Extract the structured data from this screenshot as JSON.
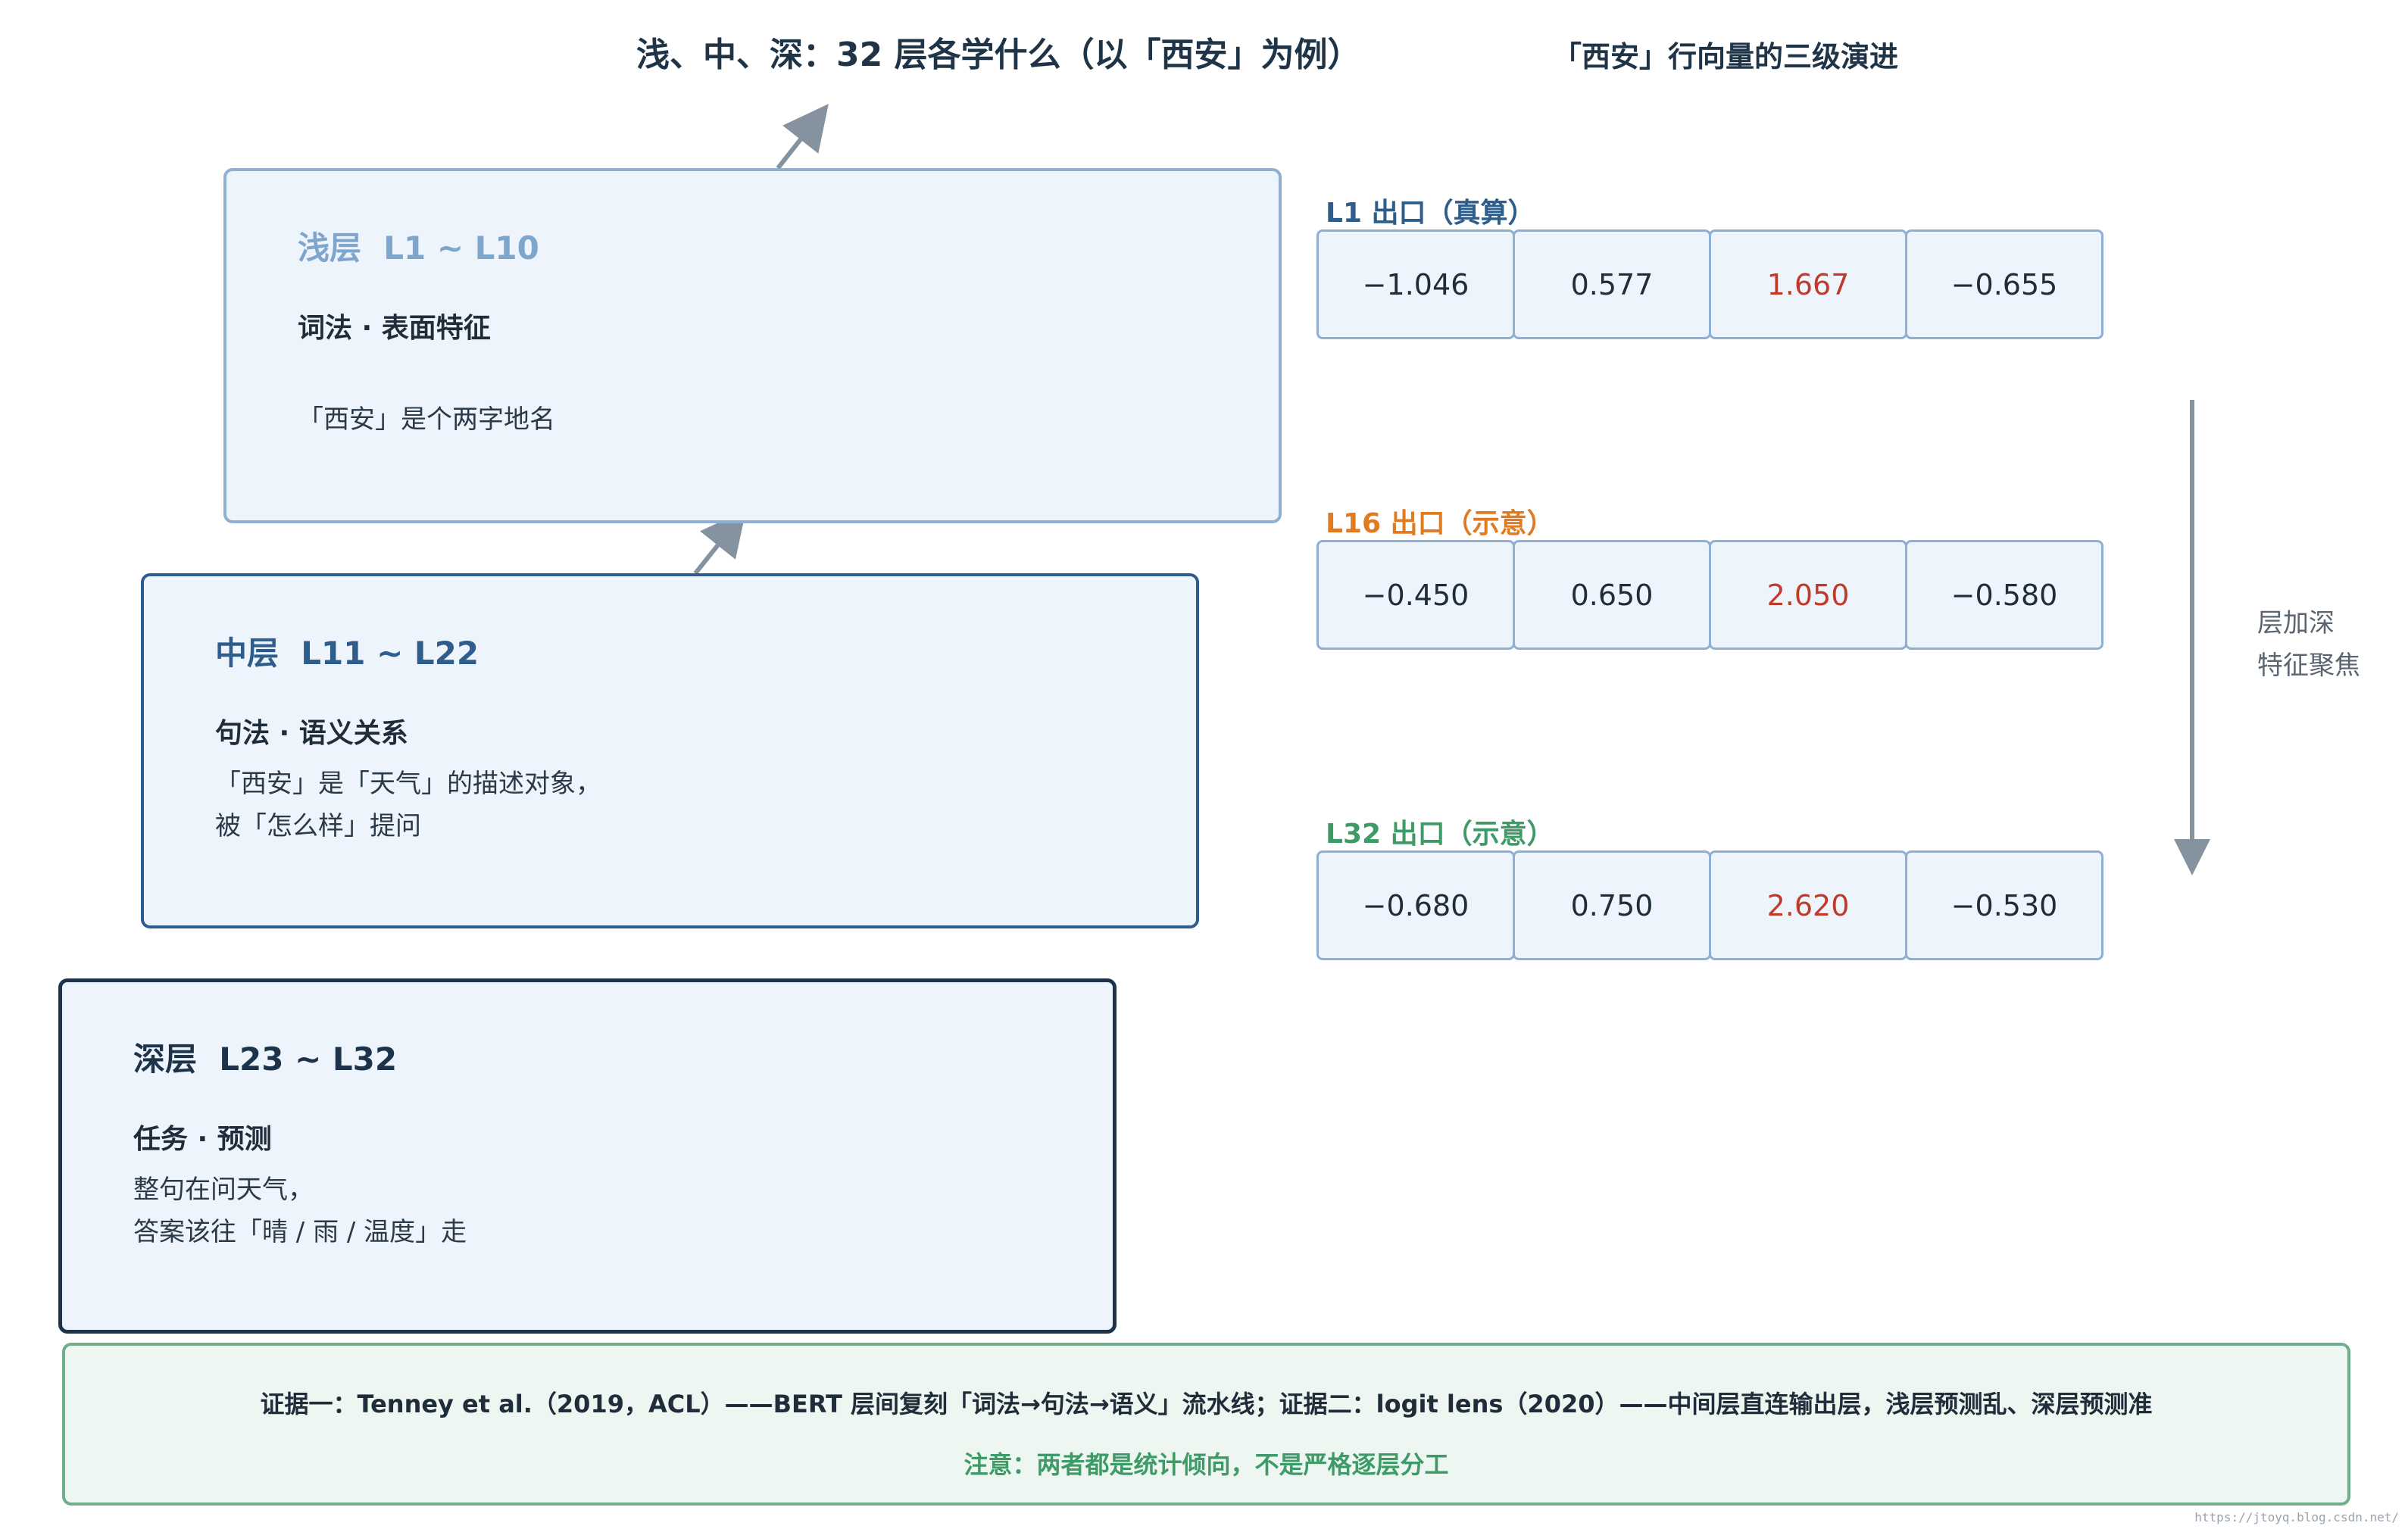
{
  "title": "浅、中、深：32 层各学什么（以「西安」为例）",
  "vector_title": "「西安」行向量的三级演进",
  "layers": [
    {
      "name": "浅层  L1 ~ L10",
      "subtitle": "词法 · 表面特征",
      "desc": [
        "「西安」是个两字地名"
      ]
    },
    {
      "name": "中层  L11 ~ L22",
      "subtitle": "句法 · 语义关系",
      "desc": [
        "「西安」是「天气」的描述对象，",
        "被「怎么样」提问"
      ]
    },
    {
      "name": "深层  L23 ~ L32",
      "subtitle": "任务 · 预测",
      "desc": [
        "整句在问天气，",
        "答案该往「晴 / 雨 / 温度」走"
      ]
    }
  ],
  "vectors": [
    {
      "label": "L1 出口（真算）",
      "color": "#2e5d8c",
      "values": [
        "−1.046",
        "0.577",
        "1.667",
        "−0.655"
      ],
      "highlight_index": 2
    },
    {
      "label": "L16 出口（示意）",
      "color": "#e07b22",
      "values": [
        "−0.450",
        "0.650",
        "2.050",
        "−0.580"
      ],
      "highlight_index": 2
    },
    {
      "label": "L32 出口（示意）",
      "color": "#3e9a66",
      "values": [
        "−0.680",
        "0.750",
        "2.620",
        "−0.530"
      ],
      "highlight_index": 2
    }
  ],
  "side_note": [
    "层加深",
    "特征聚焦"
  ],
  "evidence": {
    "text": "证据一：Tenney et al.（2019，ACL）——BERT 层间复刻「词法→句法→语义」流水线；证据二：logit lens（2020）——中间层直连输出层，浅层预测乱、深层预测准",
    "note": "注意：两者都是统计倾向，不是严格逐层分工"
  },
  "watermark": "https://jtoyq.blog.csdn.net/",
  "colors": {
    "highlight": "#c0392b",
    "arrow": "#8592a0"
  }
}
